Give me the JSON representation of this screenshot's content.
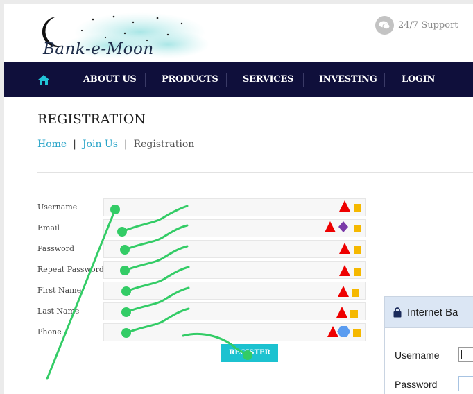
{
  "brand": {
    "name": "Bank-e-Moon"
  },
  "support": {
    "label": "24/7 Support",
    "icon": "chat-bubble-icon"
  },
  "nav": {
    "home_icon": "home-icon",
    "items": [
      {
        "label": "ABOUT US"
      },
      {
        "label": "PRODUCTS"
      },
      {
        "label": "SERVICES"
      },
      {
        "label": "INVESTING"
      },
      {
        "label": "LOGIN"
      }
    ]
  },
  "page": {
    "title": "REGISTRATION",
    "breadcrumb": [
      "Home",
      "Join Us",
      "Registration"
    ]
  },
  "form": {
    "fields": [
      {
        "label": "Username",
        "value": ""
      },
      {
        "label": "Email",
        "value": ""
      },
      {
        "label": "Password",
        "value": ""
      },
      {
        "label": "Repeat Password",
        "value": ""
      },
      {
        "label": "First Name",
        "value": ""
      },
      {
        "label": "Last Name",
        "value": ""
      },
      {
        "label": "Phone",
        "value": ""
      }
    ],
    "submit_label": "REGISTER"
  },
  "internet_banking": {
    "title": "Internet Ba",
    "username_label": "Username",
    "password_label": "Password"
  },
  "colors": {
    "nav_bg": "#0f0f3b",
    "accent": "#1cc2d0",
    "link": "#29a4c8",
    "annotation_green": "#33cc66",
    "marker_red": "#ee0000",
    "marker_yellow": "#f5b800",
    "marker_purple": "#7a3aa8",
    "marker_blue": "#5a9cf0"
  }
}
